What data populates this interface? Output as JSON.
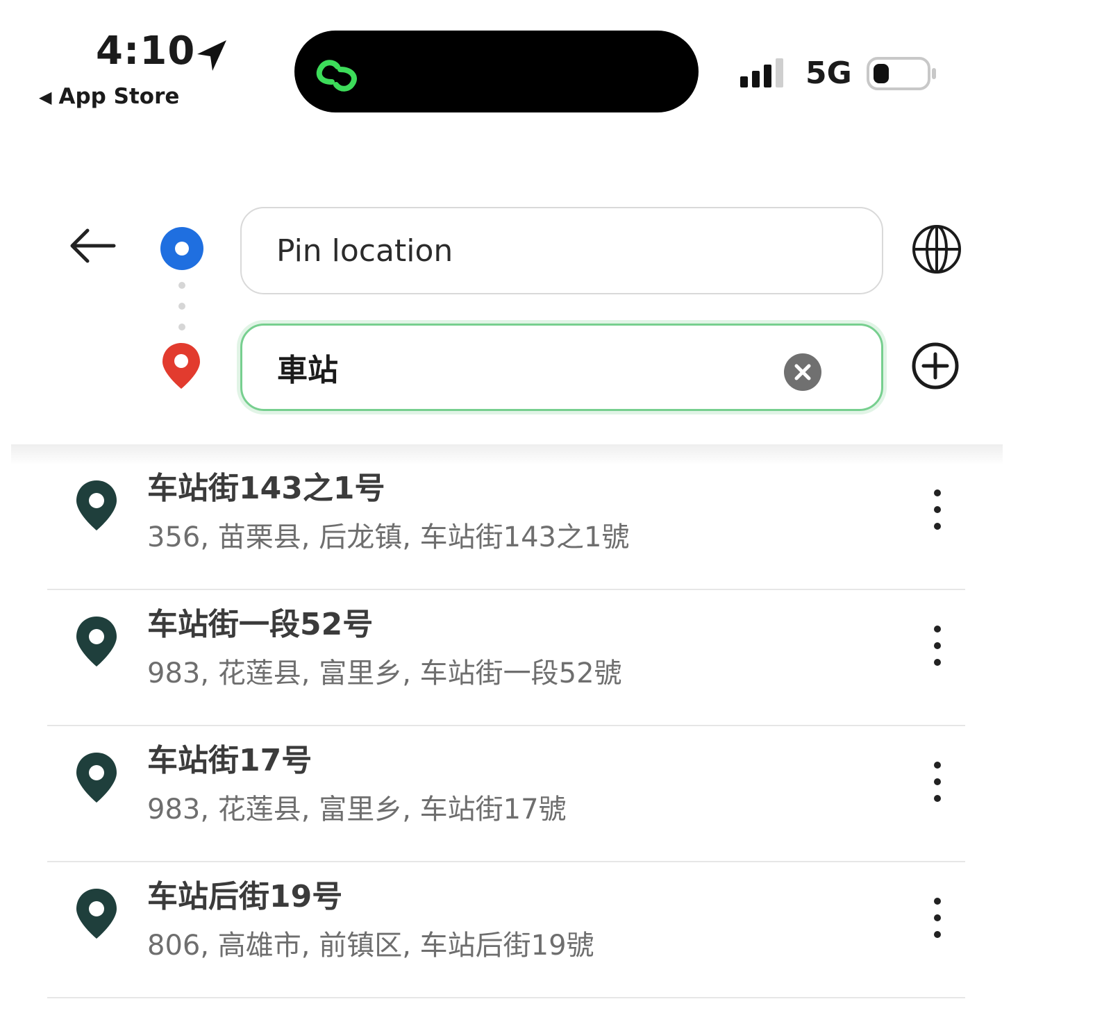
{
  "status_bar": {
    "time": "4:10",
    "back_app": "App Store",
    "network": "5G"
  },
  "search": {
    "origin_placeholder": "Pin location",
    "destination_value": "車站"
  },
  "colors": {
    "origin": "#1f6fe0",
    "destination": "#e23b2e",
    "focus_border": "#77cf8f",
    "result_pin": "#1f3f3c"
  },
  "results": [
    {
      "title": "车站街143之1号",
      "subtitle": "356, 苗栗县, 后龙镇, 车站街143之1號"
    },
    {
      "title": "车站街一段52号",
      "subtitle": "983, 花莲县, 富里乡, 车站街一段52號"
    },
    {
      "title": "车站街17号",
      "subtitle": "983, 花莲县, 富里乡, 车站街17號"
    },
    {
      "title": "车站后街19号",
      "subtitle": "806, 高雄市, 前镇区, 车站后街19號"
    }
  ]
}
